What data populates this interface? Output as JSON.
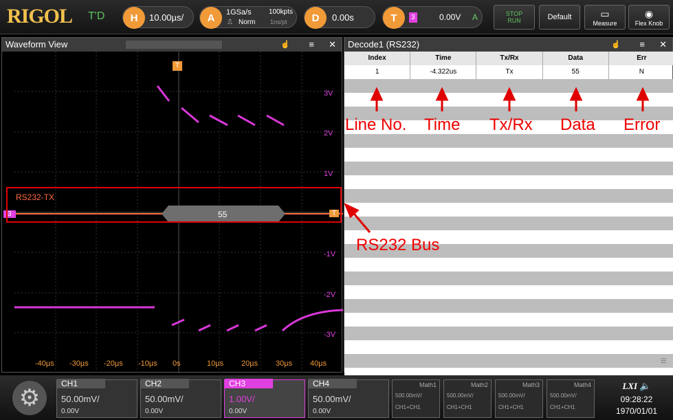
{
  "topbar": {
    "logo": "RIGOL",
    "mode": "T'D",
    "horizontal": {
      "key": "H",
      "scale": "10.00µs/"
    },
    "acquire": {
      "key": "A",
      "rate": "1GSa/s",
      "depth": "100kpts",
      "type": "Norm",
      "interval": "1ns/pt"
    },
    "delay": {
      "key": "D",
      "value": "0.00s"
    },
    "trigger": {
      "key": "T",
      "source": "3",
      "level": "0.00V",
      "coupling": "A"
    },
    "stop_run": "STOP\nRUN",
    "default": "Default",
    "measure": "Measure",
    "flex_knob": "Flex Knob"
  },
  "waveform": {
    "title": "Waveform View",
    "trigger_marker": "T",
    "volt_labels": [
      "3V",
      "2V",
      "1V",
      "-1V",
      "-2V",
      "-3V"
    ],
    "time_labels": [
      "-40µs",
      "-30µs",
      "-20µs",
      "-10µs",
      "0s",
      "10µs",
      "20µs",
      "30µs",
      "40µs"
    ],
    "bus_label": "RS232-TX",
    "bus_channel": "3",
    "bus_end_marker": "T",
    "bus_value": "55"
  },
  "decode": {
    "title": "Decode1 (RS232)",
    "columns": [
      "Index",
      "Time",
      "Tx/Rx",
      "Data",
      "Err"
    ],
    "rows": [
      [
        "1",
        "-4.322us",
        "Tx",
        "55",
        "N"
      ]
    ]
  },
  "annotations": {
    "line_no": "Line No.",
    "time": "Time",
    "txrx": "Tx/Rx",
    "data": "Data",
    "error": "Error",
    "bus": "RS232 Bus"
  },
  "channels": [
    {
      "name": "CH1",
      "scale": "50.00mV/",
      "offset": "0.00V",
      "color": "#555555"
    },
    {
      "name": "CH2",
      "scale": "50.00mV/",
      "offset": "0.00V",
      "color": "#555555"
    },
    {
      "name": "CH3",
      "scale": "1.00V/",
      "offset": "0.00V",
      "color": "#e040e0"
    },
    {
      "name": "CH4",
      "scale": "50.00mV/",
      "offset": "0.00V",
      "color": "#555555"
    }
  ],
  "maths": [
    {
      "name": "Math1",
      "scale": "500.00mV/",
      "src": "CH1+CH1"
    },
    {
      "name": "Math2",
      "scale": "500.00mV/",
      "src": "CH1+CH1"
    },
    {
      "name": "Math3",
      "scale": "500.00mV/",
      "src": "CH1+CH1"
    },
    {
      "name": "Math4",
      "scale": "500.00mV/",
      "src": "CH1+CH1"
    }
  ],
  "status": {
    "lxi": "LXI",
    "time": "09:28:22",
    "date": "1970/01/01"
  },
  "colors": {
    "accent": "#f19a38",
    "ch3": "#e040e0",
    "bus": "#ff6a3d",
    "annotation": "#e00000"
  }
}
